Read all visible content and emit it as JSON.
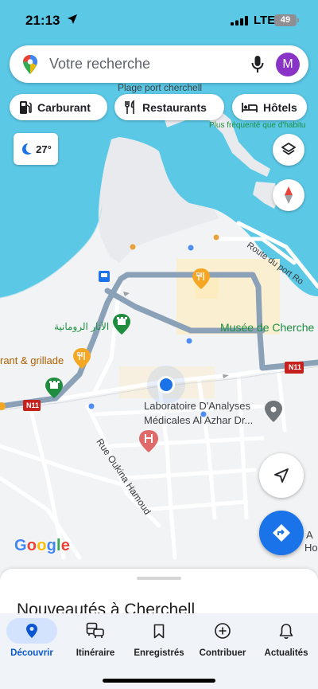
{
  "status_bar": {
    "time": "21:13",
    "network": "LTE",
    "battery": "49"
  },
  "search": {
    "placeholder": "Votre recherche",
    "avatar_letter": "M"
  },
  "chips": [
    {
      "label": "Carburant",
      "icon": "gas-station-icon"
    },
    {
      "label": "Restaurants",
      "icon": "fork-knife-icon"
    },
    {
      "label": "Hôtels",
      "icon": "bed-icon"
    }
  ],
  "weather": {
    "temperature": "27°",
    "icon": "crescent-moon-icon"
  },
  "map": {
    "labels": {
      "plage": "Plage port cherchell",
      "frequente": "Plus fréquenté que d'habitu",
      "route_port": "Route du port Ro",
      "ruins_arabic": "الآثار الرومانية",
      "musee": "Musée de Cherche",
      "restaurant": "rant & grillade",
      "labo_line1": "Laboratoire D'Analyses",
      "labo_line2": "Médicales Al Azhar Dr...",
      "rue_oukina": "Rue Oukina Hamoud",
      "road_n11_a": "N11",
      "road_n11_b": "N11",
      "edge_a": "A",
      "edge_ho": "Ho"
    },
    "google_logo": [
      "G",
      "o",
      "o",
      "g",
      "l",
      "e"
    ],
    "colors": {
      "water": "#5bc8e6",
      "land": "#f1f3f4",
      "route": "#8aa1b8",
      "google_blue": "#4285f4",
      "google_red": "#ea4335",
      "google_yellow": "#fbbc05",
      "google_green": "#34a853"
    }
  },
  "sheet": {
    "title": "Nouveautés à Cherchell"
  },
  "nav": [
    {
      "label": "Découvrir",
      "icon": "location-pin-icon",
      "active": true
    },
    {
      "label": "Itinéraire",
      "icon": "commute-icon",
      "active": false
    },
    {
      "label": "Enregistrés",
      "icon": "bookmark-icon",
      "active": false
    },
    {
      "label": "Contribuer",
      "icon": "add-circle-icon",
      "active": false
    },
    {
      "label": "Actualités",
      "icon": "bell-icon",
      "active": false
    }
  ]
}
